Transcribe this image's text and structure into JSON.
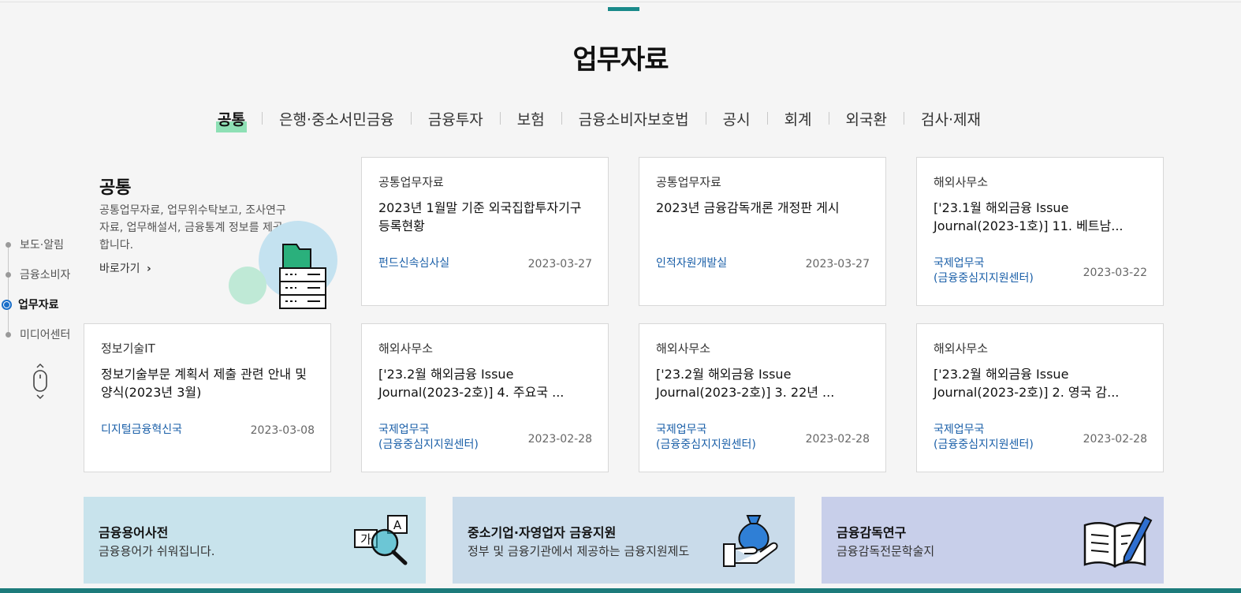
{
  "page_title": "업무자료",
  "tabs": [
    {
      "label": "공통",
      "active": true
    },
    {
      "label": "은행·중소서민금융"
    },
    {
      "label": "금융투자"
    },
    {
      "label": "보험"
    },
    {
      "label": "금융소비자보호법"
    },
    {
      "label": "공시"
    },
    {
      "label": "회계"
    },
    {
      "label": "외국환"
    },
    {
      "label": "검사·제재"
    }
  ],
  "side_nav": [
    {
      "label": "보도·알림"
    },
    {
      "label": "금융소비자"
    },
    {
      "label": "업무자료",
      "active": true
    },
    {
      "label": "미디어센터"
    }
  ],
  "intro": {
    "title": "공통",
    "description": "공통업무자료, 업무위수탁보고, 조사연구자료, 업무해설서, 금융통계 정보를 제공합니다.",
    "link_label": "바로가기"
  },
  "cards": [
    {
      "category": "공통업무자료",
      "title": "2023년 1월말 기준 외국집합투자기구 등록현황",
      "dept": "펀드신속심사실",
      "dept2": "",
      "date": "2023-03-27"
    },
    {
      "category": "공통업무자료",
      "title": "2023년 금융감독개론 개정판 게시",
      "dept": "인적자원개발실",
      "dept2": "",
      "date": "2023-03-27"
    },
    {
      "category": "해외사무소",
      "title": "['23.1월 해외금융 Issue Journal(2023-1호)] 11. 베트남...",
      "dept": "국제업무국",
      "dept2": "(금융중심지지원센터)",
      "date": "2023-03-22"
    },
    {
      "category": "정보기술IT",
      "title": "정보기술부문 계획서 제출 관련 안내 및 양식(2023년 3월)",
      "dept": "디지털금융혁신국",
      "dept2": "",
      "date": "2023-03-08"
    },
    {
      "category": "해외사무소",
      "title": "['23.2월 해외금융 Issue Journal(2023-2호)] 4. 주요국 ...",
      "dept": "국제업무국",
      "dept2": "(금융중심지지원센터)",
      "date": "2023-02-28"
    },
    {
      "category": "해외사무소",
      "title": "['23.2월 해외금융 Issue Journal(2023-2호)] 3. 22년 ...",
      "dept": "국제업무국",
      "dept2": "(금융중심지지원센터)",
      "date": "2023-02-28"
    },
    {
      "category": "해외사무소",
      "title": "['23.2월 해외금융 Issue Journal(2023-2호)] 2. 영국 감...",
      "dept": "국제업무국",
      "dept2": "(금융중심지지원센터)",
      "date": "2023-02-28"
    }
  ],
  "banners": [
    {
      "title": "금융용어사전",
      "subtitle": "금융용어가 쉬워집니다.",
      "icon": "dictionary-magnifier-icon",
      "icon_glyphs": [
        "가",
        "A"
      ],
      "color": "#c8e3ec"
    },
    {
      "title": "중소기업·자영업자 금융지원",
      "subtitle": "정부 및 금융기관에서 제공하는 금융지원제도",
      "icon": "money-bag-hand-icon",
      "color": "#c9dbea"
    },
    {
      "title": "금융감독연구",
      "subtitle": "금융감독전문학술지",
      "icon": "open-book-pen-icon",
      "color": "#c8cfea"
    }
  ],
  "colors": {
    "accent_teal": "#1a8a8a",
    "tab_highlight": "#8ee0b5",
    "dept_link": "#1a5fa8",
    "active_nav": "#1a6fc9"
  }
}
